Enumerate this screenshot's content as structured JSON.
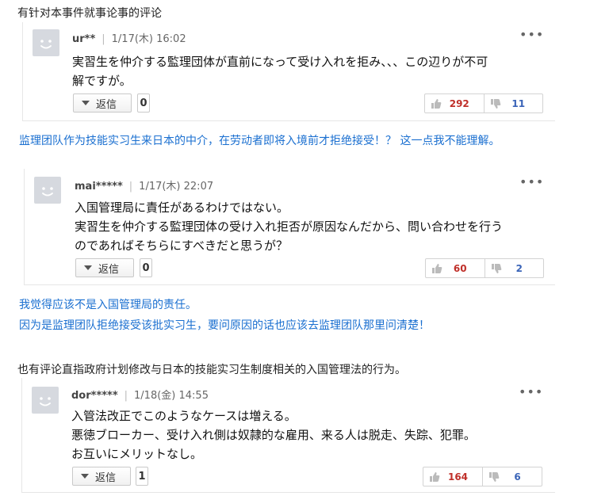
{
  "intro_1": "有针对本事件就事论事的评论",
  "comments": [
    {
      "user": "ur**",
      "date": "1/17(木) 16:02",
      "lines": [
        "実習生を仲介する監理団体が直前になって受け入れを拒み、、、この辺りが不可",
        "解ですが。"
      ],
      "reply_label": "返信",
      "reply_count": "0",
      "likes": "292",
      "dislikes": "11"
    },
    {
      "user": "mai*****",
      "date": "1/17(木) 22:07",
      "lines": [
        "入国管理局に責任があるわけではない。",
        "実習生を仲介する監理団体の受け入れ拒否が原因なんだから、問い合わせを行う",
        "のであればそちらにすべきだと思うが？"
      ],
      "reply_label": "返信",
      "reply_count": "0",
      "likes": "60",
      "dislikes": "2"
    },
    {
      "user": "dor*****",
      "date": "1/18(金) 14:55",
      "lines": [
        "入管法改正でこのようなケースは増える。",
        "悪徳ブローカー、受け入れ側は奴隷的な雇用、来る人は脱走、失踪、犯罪。",
        "お互いにメリットなし。"
      ],
      "reply_label": "返信",
      "reply_count": "1",
      "likes": "164",
      "dislikes": "6"
    }
  ],
  "translation_1": "监理团队作为技能实习生来日本的中介，在劳动者即将入境前才拒绝接受！？ 这一点我不能理解。",
  "translation_2a": "我觉得应该不是入国管理局的责任。",
  "translation_2b": "因为是监理团队拒绝接受该批实习生，要问原因的话也应该去监理团队那里问清楚！",
  "intro_2": "也有评论直指政府计划修改与日本的技能实习生制度相关的入国管理法的行为。",
  "menu_icon_text": "•••",
  "meta_separator": "|"
}
